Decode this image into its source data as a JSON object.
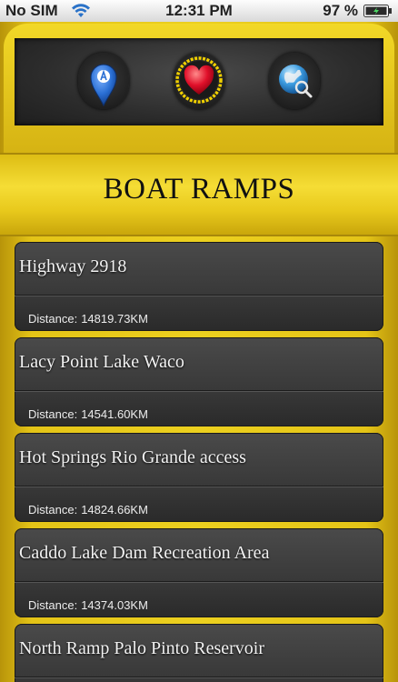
{
  "status_bar": {
    "carrier": "No SIM",
    "time": "12:31 PM",
    "battery": "97 %"
  },
  "toolbar": {
    "buttons": [
      {
        "icon": "map-pin-icon"
      },
      {
        "icon": "heart-icon"
      },
      {
        "icon": "globe-search-icon"
      }
    ]
  },
  "header": {
    "title": "BOAT RAMPS"
  },
  "list": {
    "distance_label": "Distance:",
    "items": [
      {
        "title": "Highway 2918",
        "distance": "14819.73KM"
      },
      {
        "title": "Lacy Point Lake Waco",
        "distance": "14541.60KM"
      },
      {
        "title": "Hot Springs Rio Grande access",
        "distance": "14824.66KM"
      },
      {
        "title": "Caddo Lake Dam Recreation Area",
        "distance": "14374.03KM"
      },
      {
        "title": "North Ramp Palo Pinto Reservoir",
        "distance": ""
      }
    ]
  },
  "colors": {
    "accent_yellow": "#ecd01f",
    "toolbar_dark": "#2c2c2c",
    "row_dark": "#3a3a3a",
    "heart_red": "#e0102a",
    "pin_blue": "#2a6fd4"
  }
}
